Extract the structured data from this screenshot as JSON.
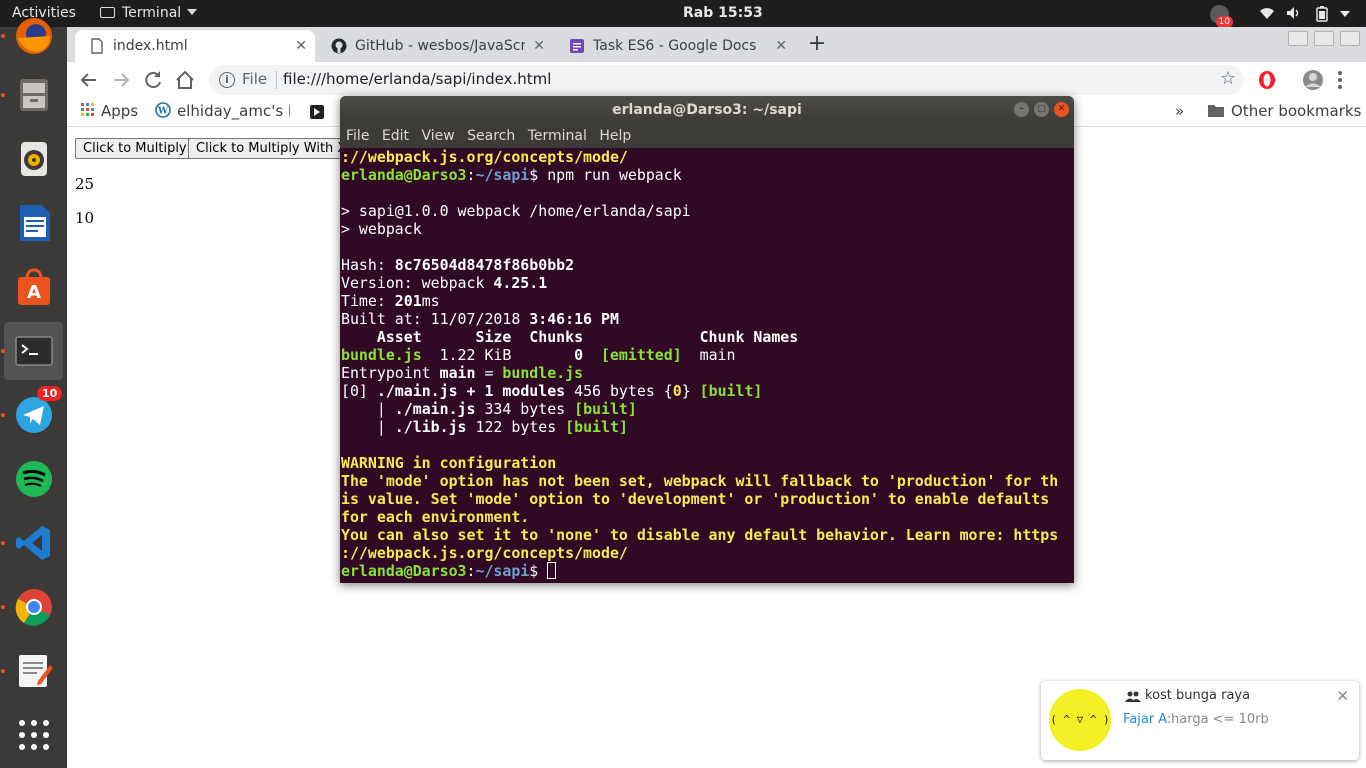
{
  "topbar": {
    "activities": "Activities",
    "app_name": "Terminal",
    "clock": "Rab 15:53",
    "tray_badge": "10"
  },
  "dock": {
    "items": [
      {
        "name": "firefox-icon"
      },
      {
        "name": "files-icon"
      },
      {
        "name": "rhythmbox-icon"
      },
      {
        "name": "writer-icon"
      },
      {
        "name": "software-center-icon"
      },
      {
        "name": "terminal-icon"
      },
      {
        "name": "telegram-icon",
        "badge": "10"
      },
      {
        "name": "spotify-icon"
      },
      {
        "name": "vscode-icon"
      },
      {
        "name": "chrome-icon"
      },
      {
        "name": "text-editor-icon"
      },
      {
        "name": "show-apps-icon"
      }
    ]
  },
  "browser": {
    "tabs": [
      {
        "label": "index.html",
        "icon": "page-icon"
      },
      {
        "label": "GitHub - wesbos/JavaScri",
        "icon": "github-icon"
      },
      {
        "label": "Task ES6 - Google Docs",
        "icon": "docs-icon"
      }
    ],
    "tab_close": "✕",
    "new_tab": "+",
    "omnibox": {
      "scheme_label": "File",
      "url": "file:///home/erlanda/sapi/index.html"
    },
    "bookmarks": {
      "apps": "Apps",
      "item1": "elhiday_amc's Bl",
      "more": "»",
      "other": "Other bookmarks"
    }
  },
  "page": {
    "button1": "Click to Multiply",
    "button2": "Click to Multiply With X",
    "output1": "25",
    "output2": "10"
  },
  "terminal": {
    "title": "erlanda@Darso3: ~/sapi",
    "menu": [
      "File",
      "Edit",
      "View",
      "Search",
      "Terminal",
      "Help"
    ],
    "lines": {
      "l1": "://webpack.js.org/concepts/mode/",
      "prompt_user": "erlanda@Darso3",
      "prompt_path": "~/sapi",
      "prompt_sym": "$ ",
      "command": "npm run webpack",
      "l4": "> sapi@1.0.0 webpack /home/erlanda/sapi",
      "l5": "> webpack",
      "hash_label": "Hash: ",
      "hash_value": "8c76504d8478f86b0bb2",
      "version_label": "Version: webpack ",
      "version_value": "4.25.1",
      "time_label": "Time: ",
      "time_value": "201",
      "time_unit": "ms",
      "built_label": "Built at: 11/07/2018 ",
      "built_time": "3:46:16 PM",
      "header": "    Asset      Size  Chunks             Chunk Names",
      "asset_name": "bundle.js",
      "asset_size": "  1.22 KiB       ",
      "asset_chunk": "0",
      "asset_emitted": "[emitted]",
      "asset_names": "  main",
      "entry_label": "Entrypoint ",
      "entry_main": "main",
      "entry_eq": " = ",
      "entry_file": "bundle.js",
      "mod0_idx": "[0] ",
      "mod0_name": "./main.js + 1 modules",
      "mod0_size": " 456 bytes {",
      "mod0_chunk": "0",
      "mod0_close": "} ",
      "built_tag": "[built]",
      "sub1_pre": "    | ",
      "sub1_name": "./main.js",
      "sub1_size": " 334 bytes ",
      "sub2_pre": "    | ",
      "sub2_name": "./lib.js",
      "sub2_size": " 122 bytes ",
      "warn1": "WARNING in configuration",
      "warn2": "The 'mode' option has not been set, webpack will fallback to 'production' for th",
      "warn3": "is value. Set 'mode' option to 'development' or 'production' to enable defaults",
      "warn4": "for each environment.",
      "warn5": "You can also set it to 'none' to disable any default behavior. Learn more: https",
      "warn6": "://webpack.js.org/concepts/mode/"
    }
  },
  "notification": {
    "title": "kost bunga raya",
    "sender": "Fajar A:",
    "message": "harga <= 10rb",
    "avatar_text": "( ^ ▽ ^ )",
    "close": "✕"
  },
  "colors": {
    "terminal_bg": "#300a24",
    "terminal_green": "#8ae234",
    "terminal_blue": "#729fcf",
    "terminal_yellow": "#fce94f",
    "ubuntu_orange": "#e95420",
    "dock_bg": "#3b3a39",
    "topbar_bg": "#1d1d1d"
  }
}
